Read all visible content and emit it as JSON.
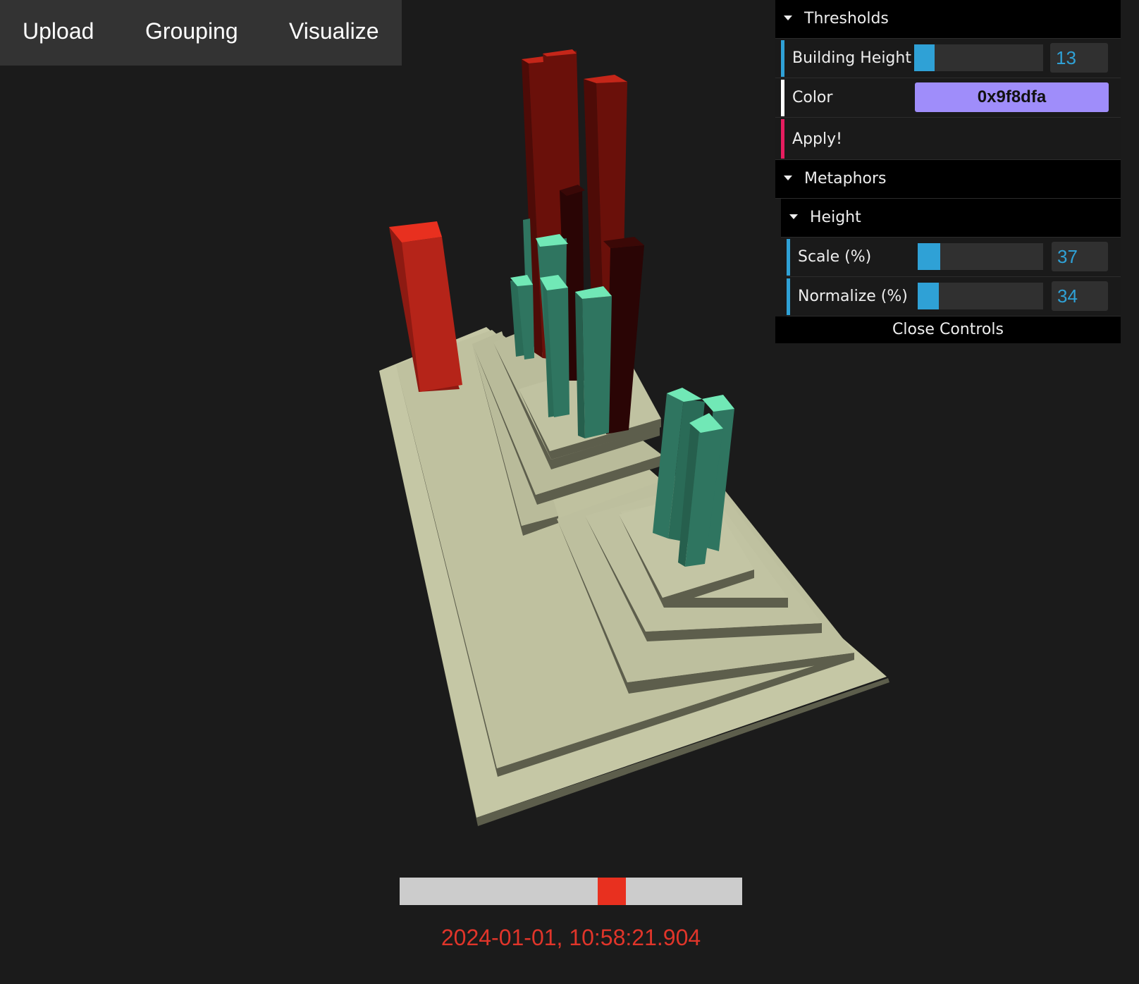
{
  "menu": {
    "upload": "Upload",
    "grouping": "Grouping",
    "visualize": "Visualize"
  },
  "gui": {
    "thresholds": {
      "title": "Thresholds",
      "building_height_label": "Building Height",
      "building_height_value": "13",
      "building_height_fraction": 0.16,
      "color_label": "Color",
      "color_value": "0x9f8dfa",
      "apply_label": "Apply!"
    },
    "metaphors": {
      "title": "Metaphors",
      "height": {
        "title": "Height",
        "scale_label": "Scale (%)",
        "scale_value": "37",
        "scale_fraction": 0.18,
        "normalize_label": "Normalize (%)",
        "normalize_value": "34",
        "normalize_fraction": 0.17
      }
    },
    "close_label": "Close Controls"
  },
  "timeline": {
    "position_fraction": 0.63,
    "timestamp": "2024-01-01, 10:58:21.904"
  },
  "colors": {
    "background": "#1b1b1b",
    "platform_top": "#c5c7a5",
    "platform_side": "#5d5e4c",
    "building_green": "#2f7560",
    "building_green_top": "#71e8b6",
    "building_red": "#b52419",
    "building_dark_red": "#6a100a",
    "building_black_red": "#2a0505",
    "slider_fill": "#2fa1d6",
    "timestamp": "#e0352a"
  },
  "icons": {
    "folder_toggle": "caret-down-icon"
  }
}
